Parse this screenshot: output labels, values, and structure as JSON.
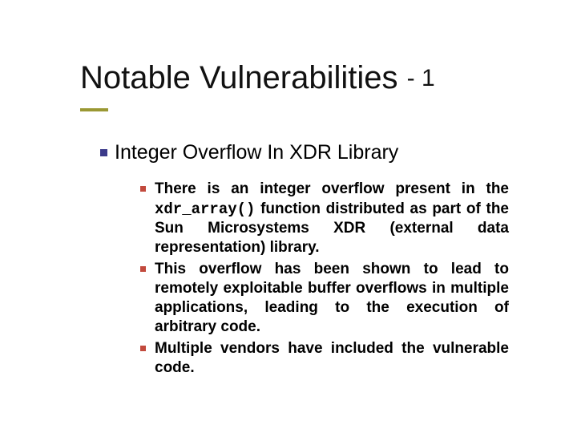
{
  "title": {
    "main": "Notable Vulnerabilities",
    "suffix": "- 1"
  },
  "bullets": {
    "heading": "Integer Overflow In XDR Library",
    "items": [
      {
        "pre": "There is an integer overflow present in the ",
        "code": "xdr_array()",
        "post": " function distributed as part of the Sun Microsystems XDR (external data representation) library."
      },
      {
        "text": "This overflow has been shown to lead to remotely exploitable buffer overflows in multiple applications, leading to the execution of arbitrary code."
      },
      {
        "text": "Multiple vendors have included the vulnerable code."
      }
    ]
  }
}
